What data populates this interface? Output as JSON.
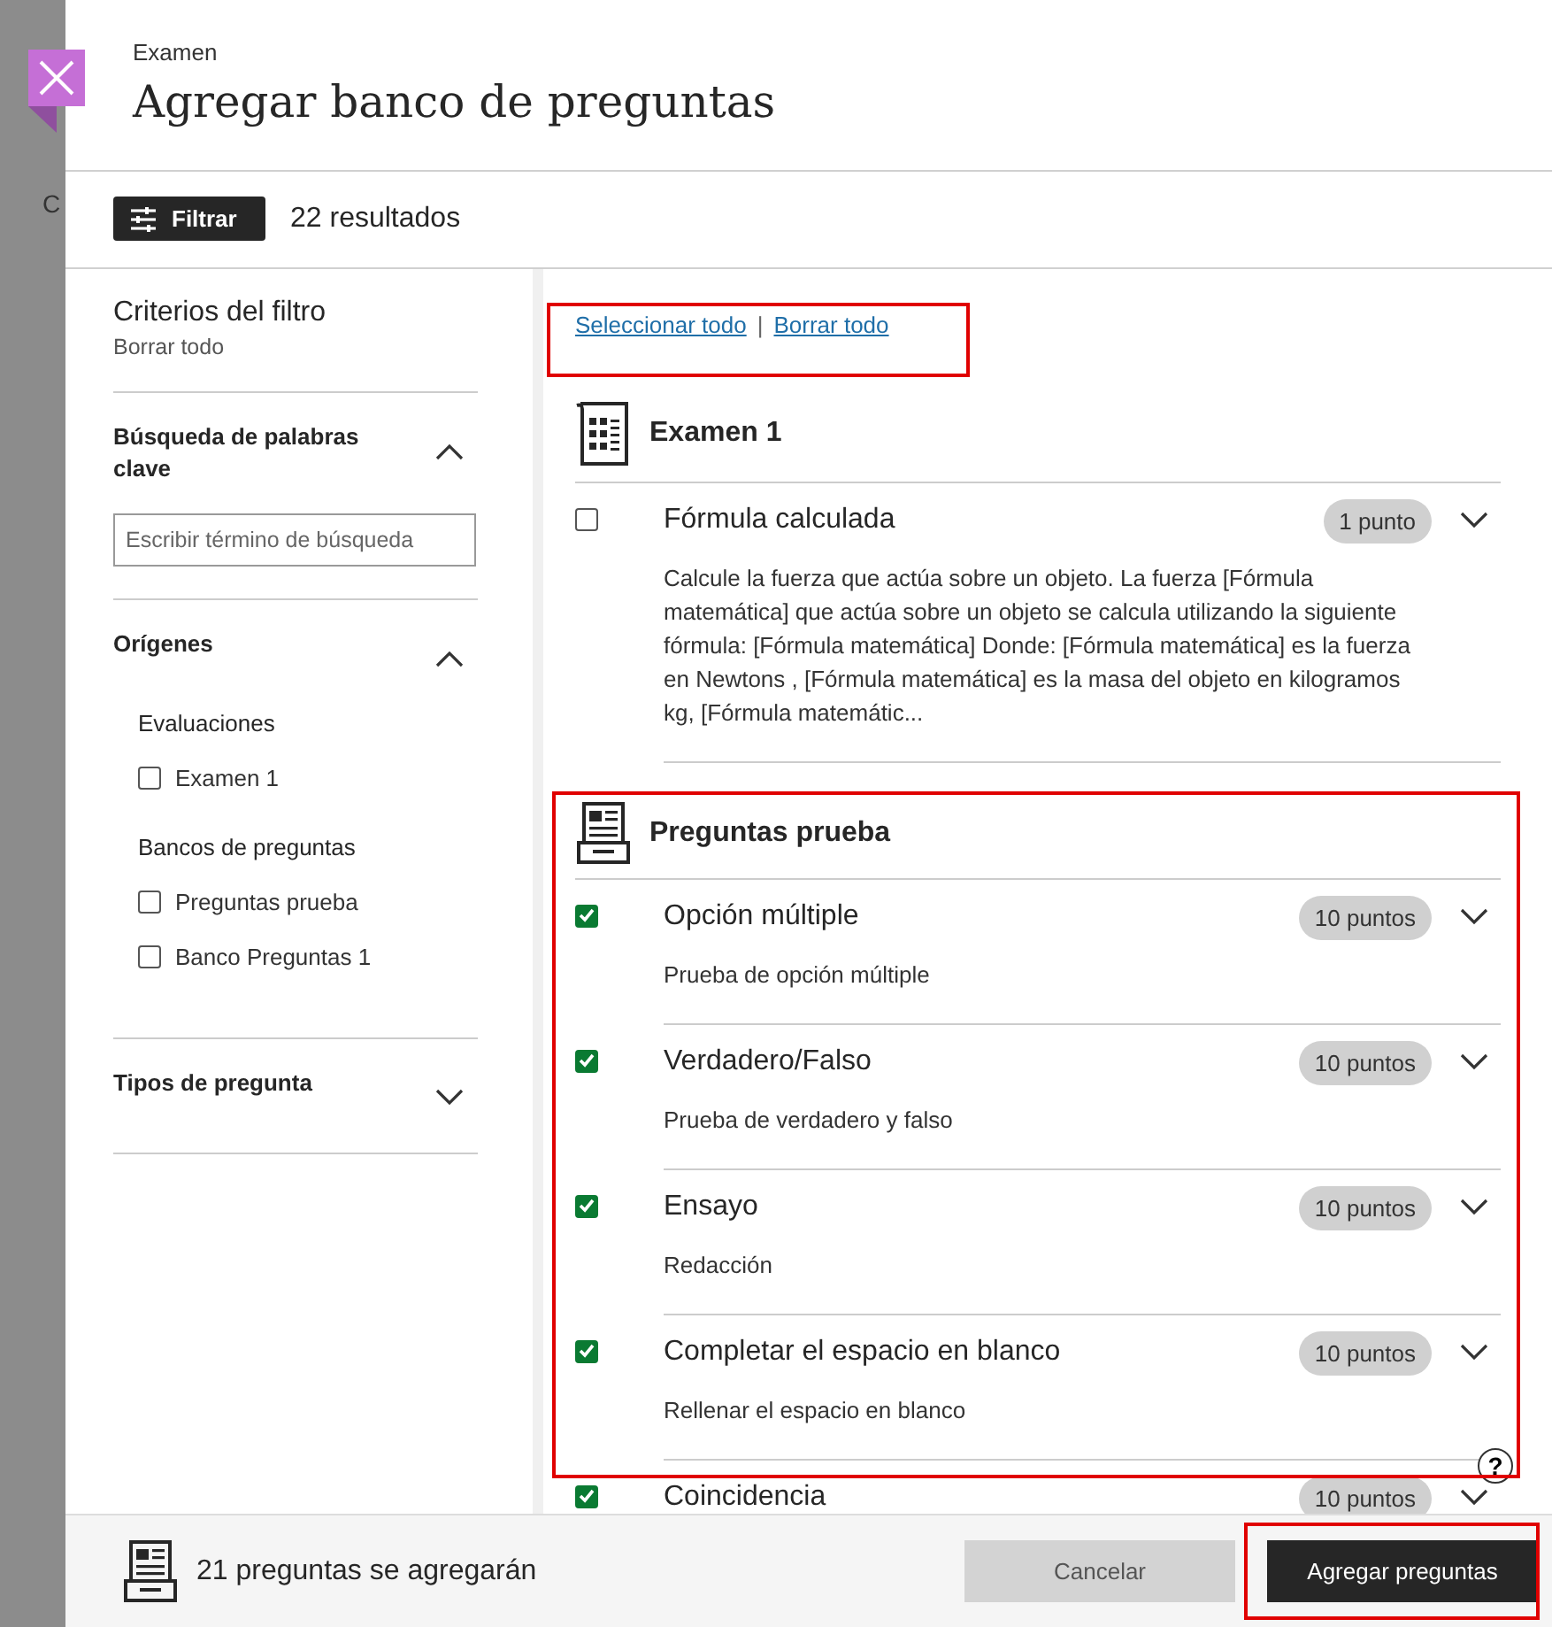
{
  "background": {
    "texts": [
      "C"
    ]
  },
  "header": {
    "breadcrumb": "Examen",
    "title": "Agregar banco de preguntas"
  },
  "toolbar": {
    "filter_button": "Filtrar",
    "results": "22 resultados"
  },
  "filters": {
    "title": "Criterios del filtro",
    "clear": "Borrar todo",
    "sections": [
      {
        "kind": "search",
        "title": "Búsqueda de palabras clave",
        "expanded": true,
        "placeholder": "Escribir término de búsqueda"
      },
      {
        "kind": "checklist",
        "title": "Orígenes",
        "expanded": true,
        "groups": [
          {
            "label": "Evaluaciones",
            "options": [
              {
                "label": "Examen 1",
                "checked": false
              }
            ]
          },
          {
            "label": "Bancos de preguntas",
            "options": [
              {
                "label": "Preguntas prueba",
                "checked": false
              },
              {
                "label": "Banco Preguntas 1",
                "checked": false
              }
            ]
          }
        ]
      },
      {
        "kind": "checklist",
        "title": "Tipos de pregunta",
        "expanded": false
      }
    ]
  },
  "links": {
    "select_all": "Seleccionar todo",
    "separator": "|",
    "clear_all": "Borrar todo"
  },
  "groups": [
    {
      "kind": "exam",
      "name": "Examen 1",
      "questions": [
        {
          "title": "Fórmula calculada",
          "points": "1 punto",
          "checked": false,
          "description": "Calcule la fuerza que actúa sobre un objeto. La fuerza [Fórmula matemática] que actúa sobre un objeto se calcula utilizando la siguiente fórmula: [Fórmula matemática] Donde: [Fórmula matemática] es la fuerza en Newtons , [Fórmula matemática] es la masa del objeto en kilogramos kg, [Fórmula matemátic..."
        }
      ]
    },
    {
      "kind": "bank",
      "name": "Preguntas prueba",
      "questions": [
        {
          "title": "Opción múltiple",
          "points": "10 puntos",
          "checked": true,
          "description": "Prueba de opción múltiple"
        },
        {
          "title": "Verdadero/Falso",
          "points": "10 puntos",
          "checked": true,
          "description": "Prueba de verdadero y falso"
        },
        {
          "title": "Ensayo",
          "points": "10 puntos",
          "checked": true,
          "description": "Redacción"
        },
        {
          "title": "Completar el espacio en blanco",
          "points": "10 puntos",
          "checked": true,
          "description": "Rellenar el espacio en blanco"
        },
        {
          "title": "Coincidencia",
          "points": "10 puntos",
          "checked": true
        }
      ]
    }
  ],
  "help": "?",
  "footer": {
    "summary": "21 preguntas se agregarán",
    "cancel": "Cancelar",
    "submit": "Agregar preguntas"
  }
}
